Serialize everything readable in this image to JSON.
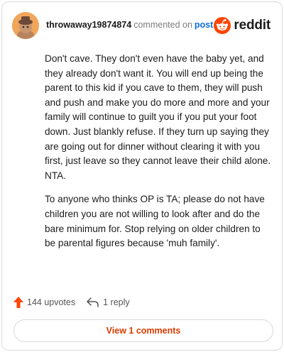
{
  "comment": {
    "username": "throwaway19874874",
    "action": "commented on",
    "post_link": "post",
    "paragraphs": [
      "Don't cave. They don't even have the baby yet, and they already don't want it. You will end up being the parent to this kid if you cave to them, they will push and push and make you do more and more and your family will continue to guilt you if you put your foot down. Just blankly refuse. If they turn up saying they are going out for dinner without clearing it with you first, just leave so they cannot leave their child alone. NTA.",
      "To anyone who thinks OP is TA; please do not have children you are not willing to look after and do the bare minimum for. Stop relying on older children to be parental figures because 'muh family'."
    ]
  },
  "brand": {
    "name": "reddit",
    "icon": "reddit-logo-icon",
    "color": "#ff4500"
  },
  "actions": {
    "upvotes": "144 upvotes",
    "replies": "1 reply",
    "upvote_icon": "upvote-arrow-icon",
    "reply_icon": "reply-arrow-icon",
    "upvote_color": "#ff4500"
  },
  "footer": {
    "view_comments_label": "View 1 comments",
    "accent": "#d93a00"
  }
}
